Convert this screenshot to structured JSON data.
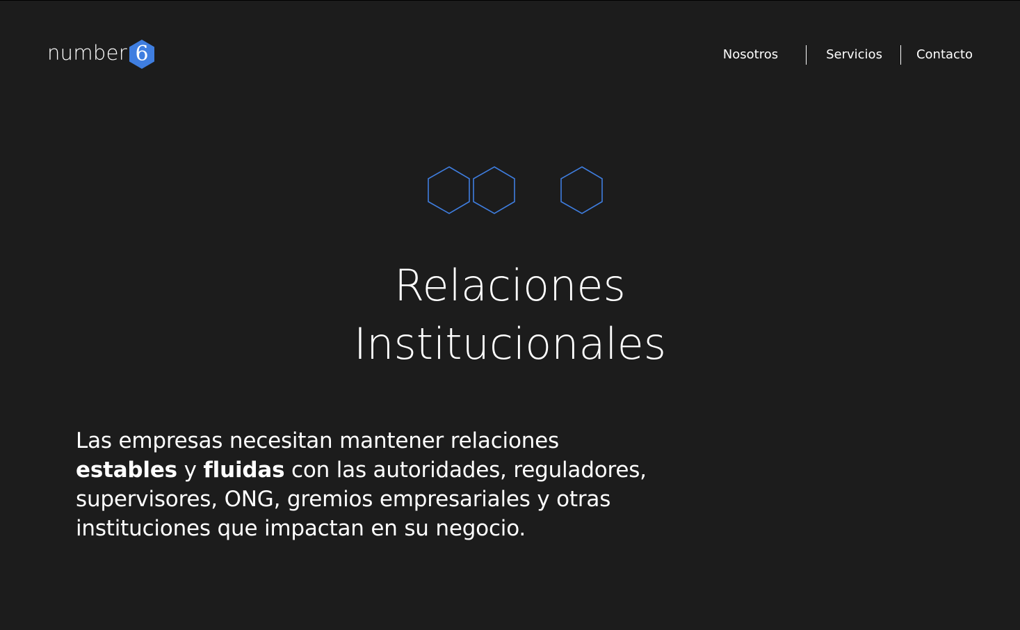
{
  "header": {
    "logo_text": "number",
    "logo_badge_number": "6",
    "nav": {
      "nosotros": "Nosotros",
      "servicios": "Servicios",
      "contacto": "Contacto"
    }
  },
  "hero": {
    "title_line1": "Relaciones",
    "title_line2": "Institucionales",
    "paragraph": {
      "part1": "Las empresas necesitan mantener relaciones",
      "bold1": "estables",
      "part2": " y ",
      "bold2": "fluidas",
      "part3": " con las autoridades, reguladores, supervisores, ONG, gremios empresariales y otras instituciones que impactan en su negocio."
    }
  },
  "colors": {
    "background": "#1c1c1c",
    "accent": "#3f7ee0",
    "text": "#ffffff"
  },
  "icons": [
    "hexagon-icon",
    "hexagon-icon",
    "hexagon-icon"
  ]
}
